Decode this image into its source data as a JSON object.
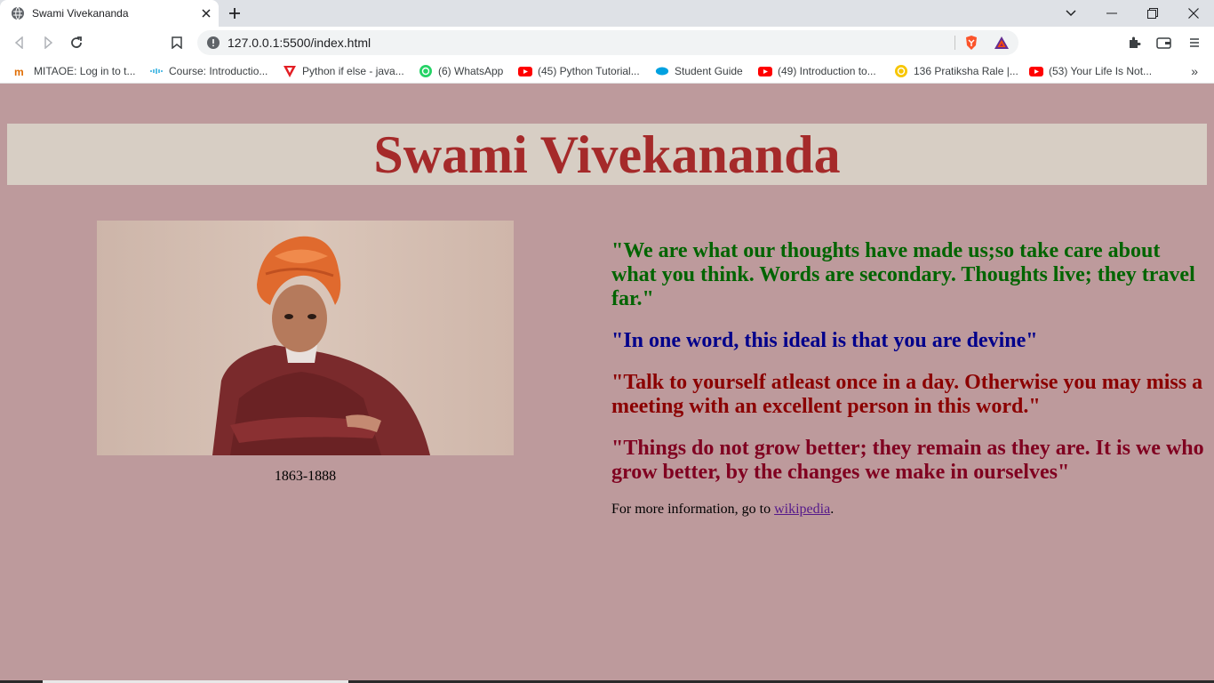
{
  "browser": {
    "tab": {
      "title": "Swami Vivekananda",
      "icon": "globe-icon"
    },
    "address_bar": {
      "url": "127.0.0.1:5500/index.html",
      "icon": "info-icon"
    },
    "bookmarks": [
      {
        "label": "MITAOE: Log in to t...",
        "icon": "mitaoe-icon"
      },
      {
        "label": "Course: Introductio...",
        "icon": "cisco-icon"
      },
      {
        "label": "Python if else - java...",
        "icon": "vpn-icon"
      },
      {
        "label": "(6) WhatsApp",
        "icon": "whatsapp-icon"
      },
      {
        "label": "(45) Python Tutorial...",
        "icon": "youtube-icon"
      },
      {
        "label": "Student Guide",
        "icon": "salesforce-icon"
      },
      {
        "label": "(49) Introduction to...",
        "icon": "youtube-icon"
      },
      {
        "label": "136 Pratiksha Rale |...",
        "icon": "coin-icon"
      },
      {
        "label": "(53) Your Life Is Not...",
        "icon": "youtube-icon"
      }
    ],
    "more_bookmarks": "»"
  },
  "page": {
    "heading": "Swami Vivekananda",
    "portrait_alt": "portrait",
    "caption": "1863-1888",
    "quotes": [
      "\"We are what our thoughts have made us;so take care about what you think. Words are secondary. Thoughts live; they travel far.\"",
      "\"In one word, this ideal is that you are devine\"",
      "\"Talk to yourself atleast once in a day. Otherwise you may miss a meeting with an excellent person in this word.\"",
      "\"Things do not grow better; they remain as they are. It is we who grow better, by the changes we make in ourselves\""
    ],
    "more_info": {
      "prefix": "For more information, go to ",
      "link": "wikipedia",
      "suffix": "."
    }
  },
  "colors": {
    "page_bg": "#bd9a9c",
    "heading_bg": "#d7cec4",
    "heading_text": "#a52a2a",
    "quote1": "#006400",
    "quote2": "#00008b",
    "quote3": "#8b0000",
    "quote4": "#800020"
  }
}
